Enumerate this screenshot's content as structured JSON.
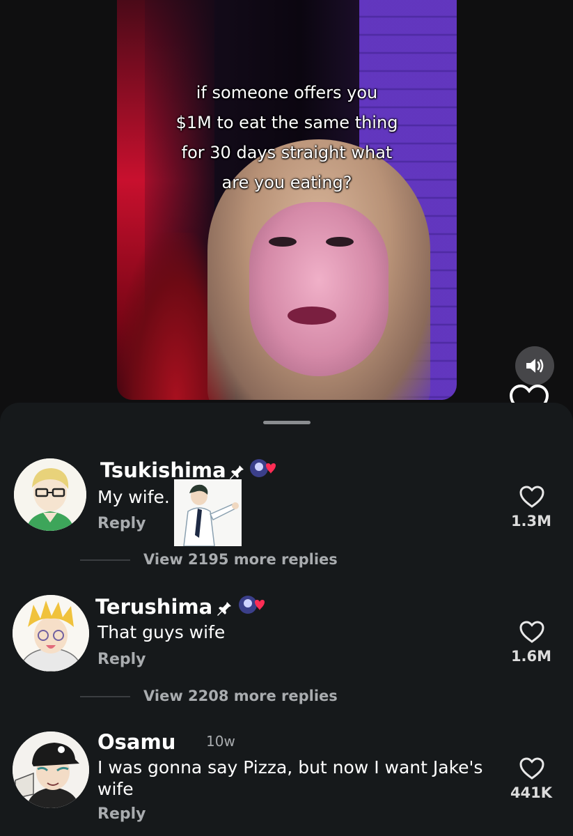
{
  "video": {
    "caption_lines": [
      "if someone offers you",
      "$1M to eat the same thing",
      "for 30 days straight what",
      "are you eating?"
    ]
  },
  "icons": {
    "sound": "speaker-icon",
    "like": "heart-icon",
    "pin": "pin-icon"
  },
  "comments": [
    {
      "username": "Tsukishima",
      "text": "My wife.",
      "reply_label": "Reply",
      "likes": "1.3M",
      "view_more": "View 2195 more replies"
    },
    {
      "username": "Terushima",
      "text": "That guys wife",
      "reply_label": "Reply",
      "likes": "1.6M",
      "view_more": "View 2208 more replies"
    },
    {
      "username": "Osamu",
      "time": "10w",
      "text_lines": [
        "I was gonna say Pizza, but now I want Jake's",
        "wife"
      ],
      "reply_label": "Reply",
      "likes": "441K"
    }
  ]
}
